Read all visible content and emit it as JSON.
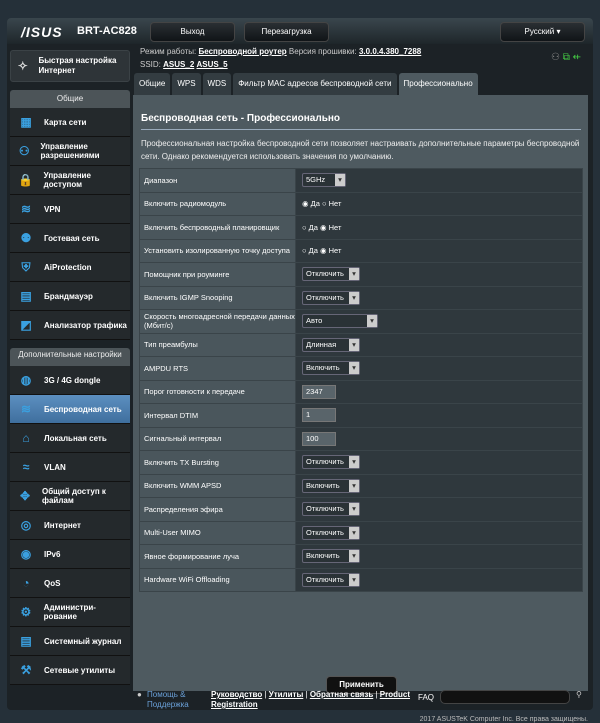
{
  "header": {
    "logo": "/ISUS",
    "model": "BRT-AC828",
    "logout": "Выход",
    "reboot": "Перезагрузка",
    "language": "Русский"
  },
  "info": {
    "mode_label": "Режим работы:",
    "mode": "Беспроводной роутер",
    "fw_label": "Версия прошивки:",
    "fw": "3.0.0.4.380_7288",
    "ssid_label": "SSID:",
    "ssid1": "ASUS_2",
    "ssid2": "ASUS_5"
  },
  "sidebar": {
    "qis": "Быстрая настройка Интернет",
    "general": "Общие",
    "general_items": [
      {
        "label": "Карта сети",
        "icon": "map"
      },
      {
        "label": "Управление разрешениями",
        "icon": "users"
      },
      {
        "label": "Управление доступом",
        "icon": "lock"
      },
      {
        "label": "VPN",
        "icon": "vpn"
      },
      {
        "label": "Гостевая сеть",
        "icon": "guest"
      },
      {
        "label": "AiProtection",
        "icon": "shield"
      },
      {
        "label": "Брандмауэр",
        "icon": "firewall"
      },
      {
        "label": "Анализатор трафика",
        "icon": "chart"
      }
    ],
    "advanced": "Дополнительные настройки",
    "advanced_items": [
      {
        "label": "3G / 4G dongle",
        "icon": "globe"
      },
      {
        "label": "Беспроводная сеть",
        "icon": "wifi",
        "active": true
      },
      {
        "label": "Локальная сеть",
        "icon": "home"
      },
      {
        "label": "VLAN",
        "icon": "vlan"
      },
      {
        "label": "Общий доступ к файлам",
        "icon": "share"
      },
      {
        "label": "Интернет",
        "icon": "internet"
      },
      {
        "label": "IPv6",
        "icon": "ipv6"
      },
      {
        "label": "QoS",
        "icon": "qos"
      },
      {
        "label": "Администри- рование",
        "icon": "admin"
      },
      {
        "label": "Системный журнал",
        "icon": "log"
      },
      {
        "label": "Сетевые утилиты",
        "icon": "tools"
      }
    ]
  },
  "tabs": [
    "Общие",
    "WPS",
    "WDS",
    "Фильтр MAC адресов беспроводной сети",
    "Профессионально"
  ],
  "main": {
    "title": "Беспроводная сеть - Профессионально",
    "description": "Профессиональная настройка беспроводной сети позволяет настраивать дополнительные параметры беспроводной сети. Однако рекомендуется использовать значения по умолчанию.",
    "apply": "Применить",
    "rows": [
      {
        "label": "Диапазон",
        "type": "select",
        "value": "5GHz"
      },
      {
        "label": "Включить радиомодуль",
        "type": "radio",
        "options": [
          "Да",
          "Нет"
        ],
        "selected": 0
      },
      {
        "label": "Включить беспроводный планировщик",
        "type": "radio",
        "options": [
          "Да",
          "Нет"
        ],
        "selected": 1
      },
      {
        "label": "Установить изолированную точку доступа",
        "type": "radio",
        "options": [
          "Да",
          "Нет"
        ],
        "selected": 1
      },
      {
        "label": "Помощник при роуминге",
        "type": "select",
        "value": "Отключить"
      },
      {
        "label": "Включить IGMP Snooping",
        "type": "select",
        "value": "Отключить"
      },
      {
        "label": "Скорость многоадресной передачи данных (Мбит/с)",
        "type": "select",
        "value": "Авто",
        "wide": true
      },
      {
        "label": "Тип преамбулы",
        "type": "select",
        "value": "Длинная"
      },
      {
        "label": "AMPDU RTS",
        "type": "select",
        "value": "Включить"
      },
      {
        "label": "Порог готовности к передаче",
        "type": "input",
        "value": "2347"
      },
      {
        "label": "Интервал DTIM",
        "type": "input",
        "value": "1"
      },
      {
        "label": "Сигнальный интервал",
        "type": "input",
        "value": "100"
      },
      {
        "label": "Включить TX Bursting",
        "type": "select",
        "value": "Отключить"
      },
      {
        "label": "Включить WMM APSD",
        "type": "select",
        "value": "Включить"
      },
      {
        "label": "Распределения эфира",
        "type": "select",
        "value": "Отключить"
      },
      {
        "label": "Multi-User MIMO",
        "type": "select",
        "value": "Отключить"
      },
      {
        "label": "Явное формирование луча",
        "type": "select",
        "value": "Включить"
      },
      {
        "label": "Hardware WiFi Offloading",
        "type": "select",
        "value": "Отключить"
      }
    ]
  },
  "footer": {
    "help": "Помощь & Поддержка",
    "links": [
      "Руководство",
      "Утилиты",
      "Обратная связь",
      "Product Registration"
    ],
    "faq": "FAQ",
    "copyright": "2017 ASUSTeK Computer Inc. Все права защищены."
  }
}
